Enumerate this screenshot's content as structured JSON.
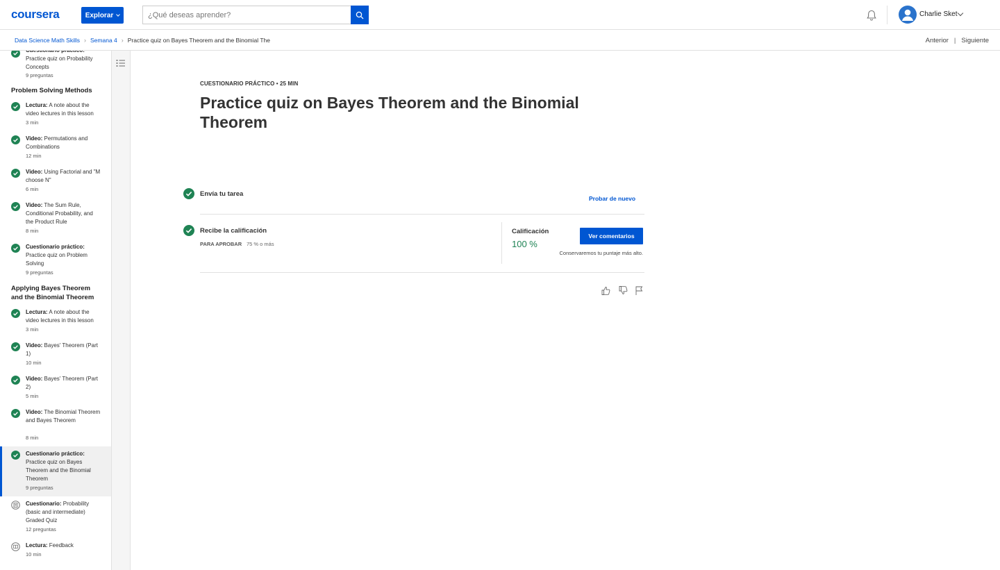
{
  "header": {
    "logo": "coursera",
    "explore_label": "Explorar",
    "search_placeholder": "¿Qué deseas aprender?",
    "user_name": "Charlie Sket",
    "icons": [
      "search-icon",
      "bell-icon",
      "user-avatar-icon",
      "chevron-down-icon"
    ]
  },
  "breadcrumb": {
    "items": [
      "Data Science Math Skills",
      "Semana 4"
    ],
    "current": "Practice quiz on Bayes Theorem and the Binomial The",
    "prev_label": "Anterior",
    "separator": "|",
    "next_label": "Siguiente"
  },
  "sidebar": {
    "top_item": {
      "type": "Cuestionario práctico:",
      "title": "Practice quiz on Probability Concepts",
      "meta": "9 preguntas"
    },
    "sections": [
      {
        "heading": "Problem Solving Methods",
        "items": [
          {
            "type": "Lectura:",
            "title": "A note about the video lectures in this lesson",
            "meta": "3 min"
          },
          {
            "type": "Video:",
            "title": "Permutations and Combinations",
            "meta": "12 min"
          },
          {
            "type": "Video:",
            "title": "Using Factorial and \"M choose N\"",
            "meta": "6 min"
          },
          {
            "type": "Video:",
            "title": "The Sum Rule, Conditional Probability, and the Product Rule",
            "meta": "8 min"
          },
          {
            "type": "Cuestionario práctico:",
            "title": "Practice quiz on Problem Solving",
            "meta": "9 preguntas"
          }
        ]
      },
      {
        "heading": "Applying Bayes Theorem and the Binomial Theorem",
        "items": [
          {
            "type": "Lectura:",
            "title": "A note about the video lectures in this lesson",
            "meta": "3 min"
          },
          {
            "type": "Video:",
            "title": "Bayes' Theorem (Part 1)",
            "meta": "10 min"
          },
          {
            "type": "Video:",
            "title": "Bayes' Theorem (Part 2)",
            "meta": "5 min"
          },
          {
            "type": "Video:",
            "title": "The Binomial Theorem and Bayes Theorem",
            "meta": "8 min"
          },
          {
            "type": "Cuestionario práctico:",
            "title": "Practice quiz on Bayes Theorem and the Binomial Theorem",
            "meta": "9 preguntas"
          },
          {
            "type": "Cuestionario:",
            "title": "Probability (basic and intermediate) Graded Quiz",
            "meta": "12 preguntas"
          },
          {
            "type": "Lectura:",
            "title": "Feedback",
            "meta": "10 min"
          }
        ]
      }
    ]
  },
  "main": {
    "kicker": "CUESTIONARIO PRÁCTICO • 25 MIN",
    "title": "Practice quiz on Bayes Theorem and the Binomial Theorem",
    "submit_label": "Envía tu tarea",
    "retry_label": "Probar de nuevo",
    "receive_label": "Recibe la calificación",
    "pass_label": "PARA APROBAR",
    "pass_value": "75 % o más",
    "grade_label": "Calificación",
    "grade_value": "100 %",
    "comments_label": "Ver comentarios",
    "keep_note": "Conservaremos tu puntaje más alto."
  },
  "colors": {
    "brand": "#0056d2",
    "success": "#1f8354",
    "check": "#1f8354"
  }
}
